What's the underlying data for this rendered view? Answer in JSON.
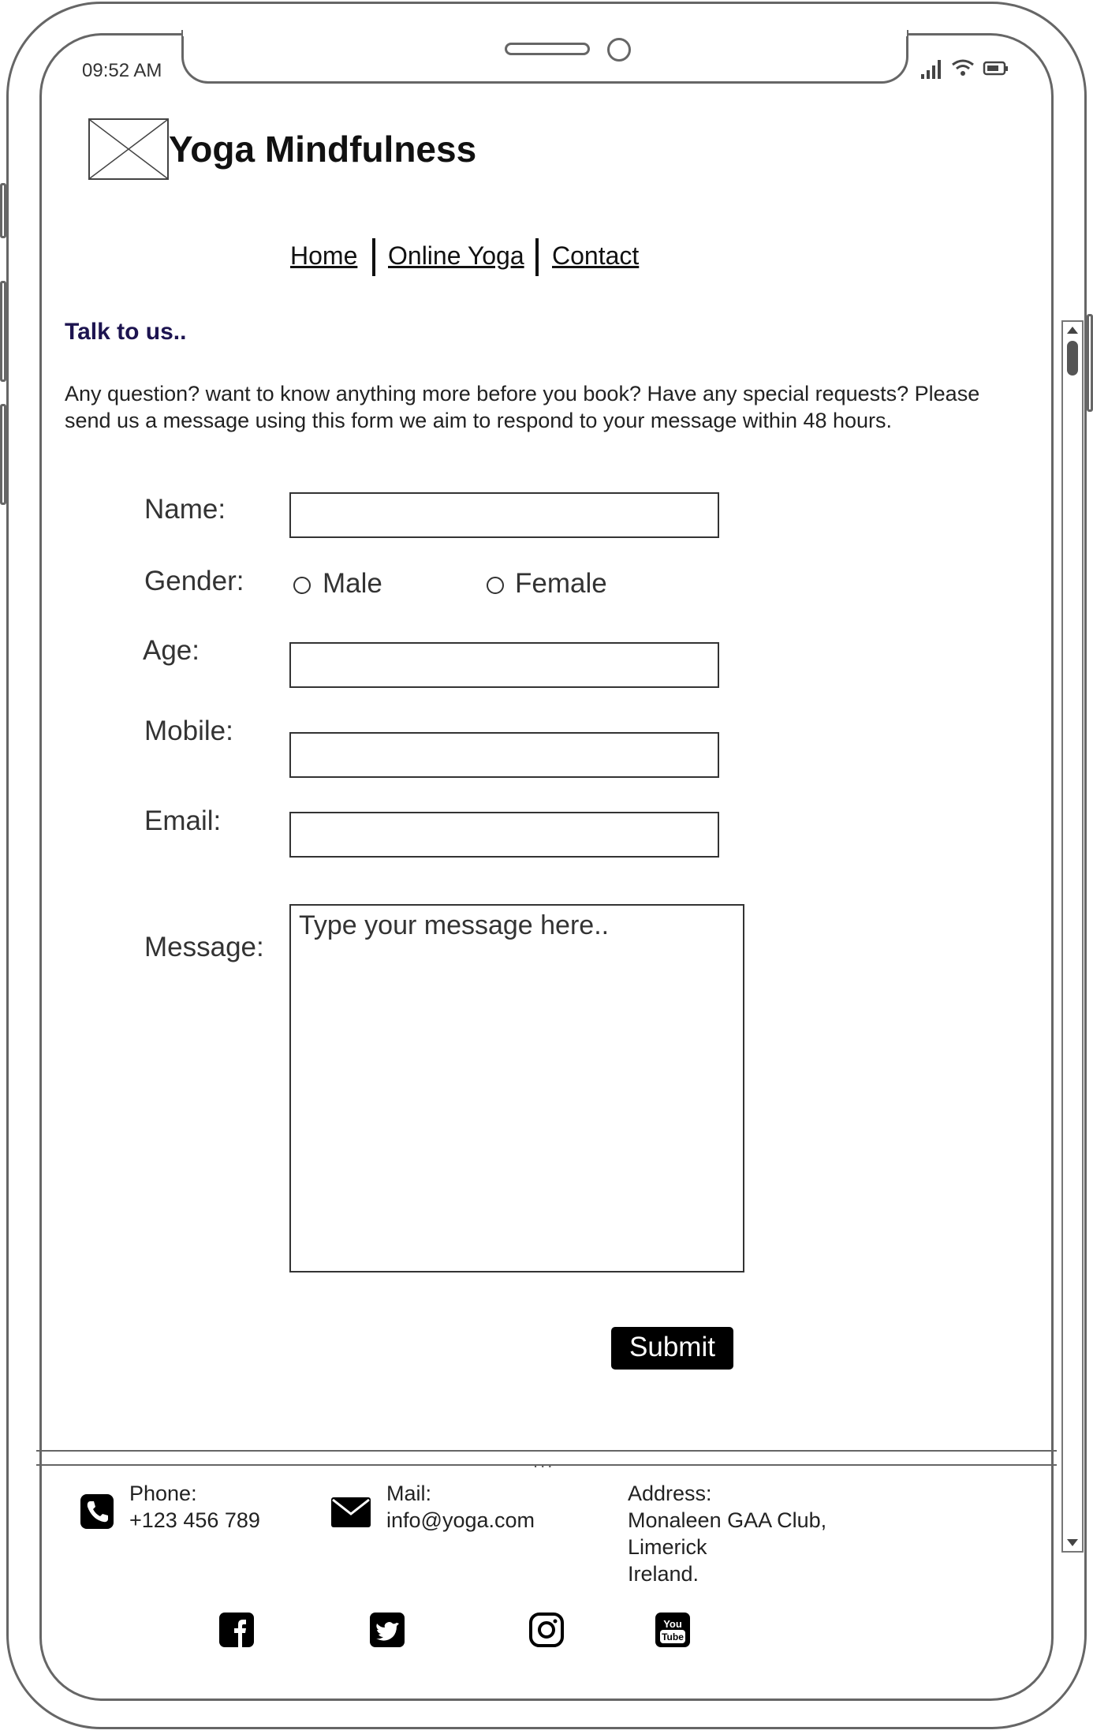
{
  "status_bar": {
    "time": "09:52 AM"
  },
  "header": {
    "title": "Yoga Mindfulness"
  },
  "nav": [
    {
      "label": "Home"
    },
    {
      "label": "Online Yoga"
    },
    {
      "label": "Contact"
    }
  ],
  "contact": {
    "heading": "Talk to us..",
    "intro_line1": "Any question? want to know anything more before you book? Have any special requests? Please",
    "intro_line2": "send us a message using this form we aim to respond to your message within 48 hours."
  },
  "form": {
    "name_label": "Name:",
    "gender_label": "Gender:",
    "gender_options": [
      "Male",
      "Female"
    ],
    "age_label": "Age:",
    "mobile_label": "Mobile:",
    "email_label": "Email:",
    "message_label": "Message:",
    "message_placeholder": "Type your message here..",
    "submit_label": "Submit"
  },
  "footer": {
    "phone_label": "Phone:",
    "phone_value": "+123 456 789",
    "mail_label": "Mail:",
    "mail_value": "info@yoga.com",
    "address_label": "Address:",
    "address_line1": "Monaleen GAA Club,",
    "address_line2": "Limerick",
    "address_line3": "Ireland.",
    "divider_dots": "...",
    "social": [
      {
        "icon": "facebook-icon"
      },
      {
        "icon": "twitter-icon"
      },
      {
        "icon": "instagram-icon"
      },
      {
        "icon": "youtube-icon",
        "text_top": "You",
        "text_bottom": "Tube"
      }
    ]
  }
}
